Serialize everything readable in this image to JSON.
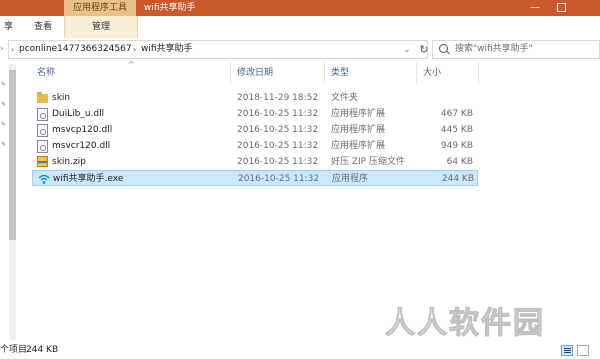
{
  "titlebar": {
    "contextual_tab": "应用程序工具",
    "title": "wifi共享助手",
    "minimize": "—"
  },
  "ribbon": {
    "tabs": [
      "享",
      "查看",
      "管理"
    ]
  },
  "address": {
    "crumbs": [
      "pconline1477366324567",
      "wifi共享助手"
    ],
    "search_placeholder": "搜索\"wifi共享助手\""
  },
  "columns": {
    "name": "名称",
    "modified": "修改日期",
    "type": "类型",
    "size": "大小"
  },
  "files": [
    {
      "name": "skin",
      "modified": "2018-11-29 18:52",
      "type": "文件夹",
      "size": "",
      "icon": "folder-icon"
    },
    {
      "name": "DuiLib_u.dll",
      "modified": "2016-10-25 11:32",
      "type": "应用程序扩展",
      "size": "467 KB",
      "icon": "dll-file-icon"
    },
    {
      "name": "msvcp120.dll",
      "modified": "2016-10-25 11:32",
      "type": "应用程序扩展",
      "size": "445 KB",
      "icon": "dll-file-icon"
    },
    {
      "name": "msvcr120.dll",
      "modified": "2016-10-25 11:32",
      "type": "应用程序扩展",
      "size": "949 KB",
      "icon": "dll-file-icon"
    },
    {
      "name": "skin.zip",
      "modified": "2016-10-25 11:32",
      "type": "好压 ZIP 压缩文件",
      "size": "64 KB",
      "icon": "zip-archive-icon"
    },
    {
      "name": "wifi共享助手.exe",
      "modified": "2016-10-25 11:32",
      "type": "应用程序",
      "size": "244 KB",
      "icon": "wifi-app-icon",
      "selected": true
    }
  ],
  "status": {
    "items": "个项目",
    "selected_size": "244 KB"
  },
  "watermark": "人人软件园",
  "colors": {
    "titlebar": "#c9582a",
    "contextual_tab": "#e6c18a",
    "selection": "#cce8ff",
    "folder": "#e8b94c"
  }
}
